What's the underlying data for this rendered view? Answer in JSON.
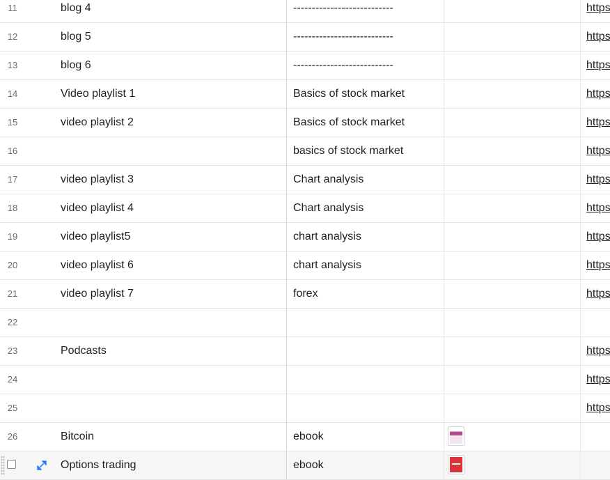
{
  "rows": [
    {
      "num": "11",
      "name": "blog 4",
      "category": "---------------------------",
      "link": "https"
    },
    {
      "num": "12",
      "name": "blog 5",
      "category": "---------------------------",
      "link": "https"
    },
    {
      "num": "13",
      "name": "blog 6",
      "category": "---------------------------",
      "link": "https"
    },
    {
      "num": "14",
      "name": "Video playlist 1",
      "category": "Basics of stock market",
      "link": "https"
    },
    {
      "num": "15",
      "name": "video playlist 2",
      "category": "Basics of stock market",
      "link": "https"
    },
    {
      "num": "16",
      "name": "",
      "category": "basics of stock market",
      "link": "https"
    },
    {
      "num": "17",
      "name": "video playlist 3",
      "category": "Chart analysis",
      "link": "https"
    },
    {
      "num": "18",
      "name": "video playlist 4",
      "category": "Chart analysis",
      "link": "https"
    },
    {
      "num": "19",
      "name": "video playlist5",
      "category": "chart analysis",
      "link": "https"
    },
    {
      "num": "20",
      "name": "video playlist 6",
      "category": "chart analysis",
      "link": "https"
    },
    {
      "num": "21",
      "name": "video playlist 7",
      "category": "forex",
      "link": "https"
    },
    {
      "num": "22",
      "name": "",
      "category": "",
      "link": ""
    },
    {
      "num": "23",
      "name": "Podcasts",
      "category": "",
      "link": "https"
    },
    {
      "num": "24",
      "name": "",
      "category": "",
      "link": "https"
    },
    {
      "num": "25",
      "name": "",
      "category": "",
      "link": "https"
    },
    {
      "num": "26",
      "name": "Bitcoin",
      "category": "ebook",
      "link": "",
      "attachment": "ebook-cover-thumbnail"
    },
    {
      "num": "",
      "name": "Options trading",
      "category": "ebook",
      "link": "",
      "attachment": "ebook-cover-thumbnail",
      "hovered": true
    }
  ],
  "colors": {
    "expand_icon": "#2d7ff9",
    "bitcoin_cover": "#b5488f",
    "options_cover": "#d9333a"
  }
}
